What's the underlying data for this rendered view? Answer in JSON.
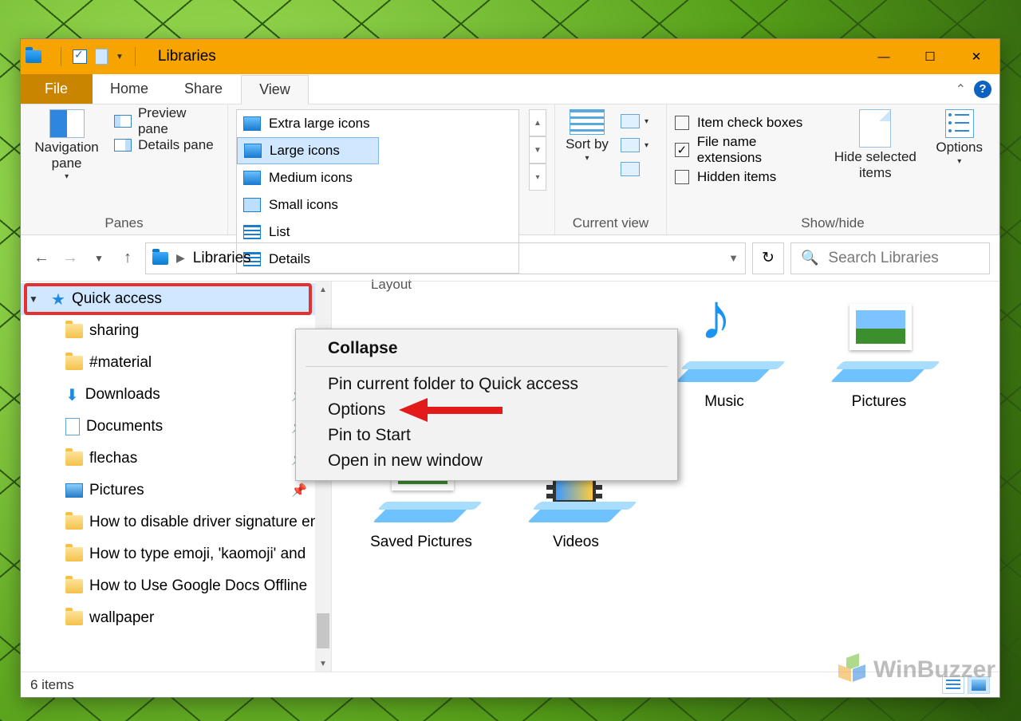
{
  "window": {
    "title": "Libraries"
  },
  "tabs": {
    "file": "File",
    "home": "Home",
    "share": "Share",
    "view": "View"
  },
  "ribbon": {
    "panes": {
      "nav": "Navigation pane",
      "preview": "Preview pane",
      "details": "Details pane",
      "group": "Panes"
    },
    "layout": {
      "extra_large": "Extra large icons",
      "large": "Large icons",
      "medium": "Medium icons",
      "small": "Small icons",
      "list": "List",
      "details": "Details",
      "group": "Layout"
    },
    "current_view": {
      "sort_by": "Sort by",
      "group": "Current view"
    },
    "show_hide": {
      "check_boxes": "Item check boxes",
      "extensions": "File name extensions",
      "hidden": "Hidden items",
      "hide_selected": "Hide selected items",
      "options": "Options",
      "group": "Show/hide"
    }
  },
  "address": {
    "location": "Libraries",
    "search_placeholder": "Search Libraries"
  },
  "tree": {
    "quick_access": "Quick access",
    "items": [
      "sharing",
      "#material",
      "Downloads",
      "Documents",
      "flechas",
      "Pictures",
      "How to disable driver signature en",
      "How to type emoji, 'kaomoji' and",
      "How to Use Google Docs Offline",
      "wallpaper"
    ]
  },
  "content": {
    "items": [
      "Music",
      "Pictures",
      "Saved Pictures",
      "Videos"
    ]
  },
  "context_menu": {
    "collapse": "Collapse",
    "pin_current": "Pin current folder to Quick access",
    "options": "Options",
    "pin_start": "Pin to Start",
    "new_window": "Open in new window"
  },
  "status": {
    "count": "6 items"
  },
  "watermark": "WinBuzzer"
}
